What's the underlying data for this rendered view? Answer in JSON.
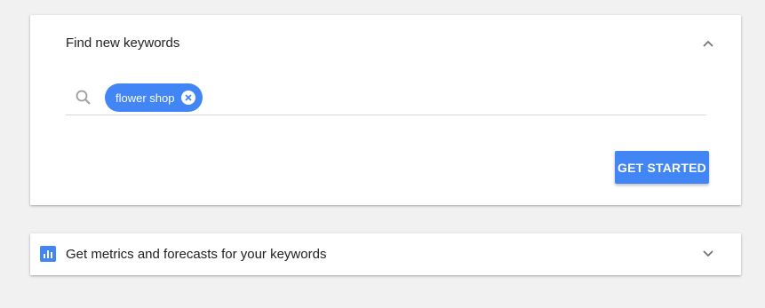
{
  "find_card": {
    "title": "Find new keywords",
    "collapse_icon": "chevron-up-icon",
    "search_icon": "search-icon",
    "keywords": [
      {
        "label": "flower shop",
        "remove_icon": "close-circle-icon"
      }
    ],
    "get_started_label": "GET STARTED"
  },
  "metrics_card": {
    "title": "Get metrics and forecasts for your keywords",
    "icon": "bar-chart-icon",
    "expand_icon": "chevron-down-icon"
  },
  "colors": {
    "accent": "#4285f4",
    "background": "#f1f1f1",
    "card": "#ffffff",
    "text": "#212121",
    "muted_icon": "#9e9e9e"
  }
}
